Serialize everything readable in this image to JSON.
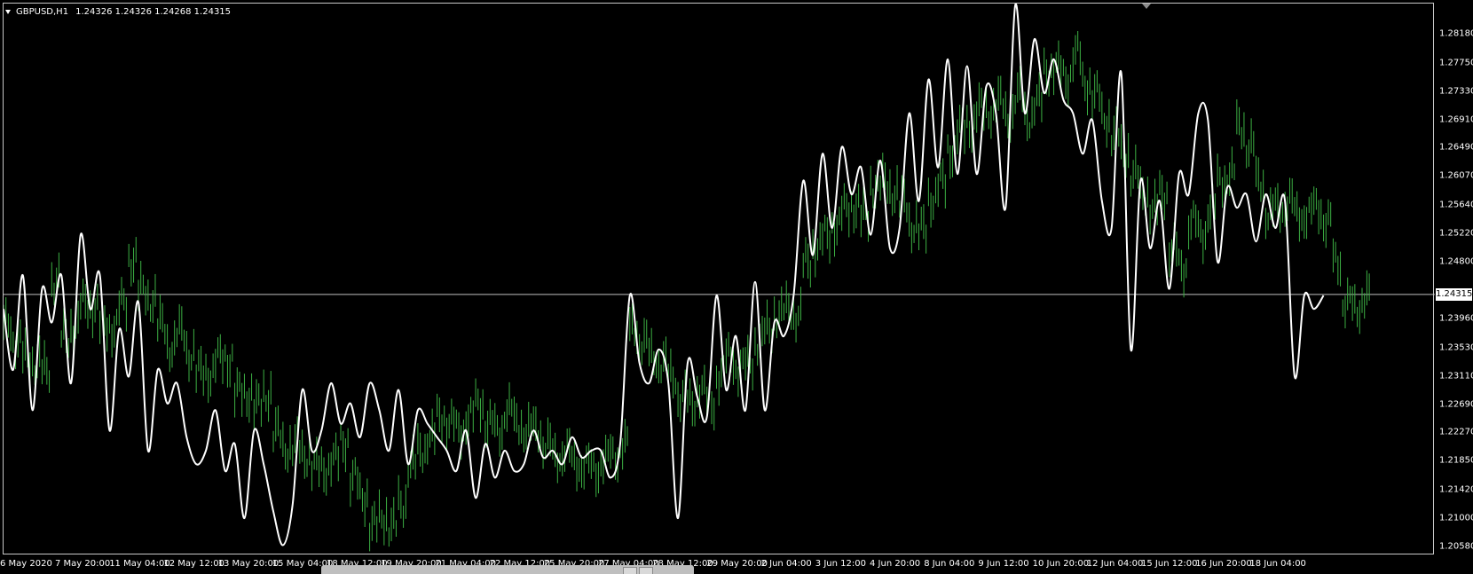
{
  "header": {
    "symbol": "GBPUSD,H1",
    "ohlc": "1.24326 1.24326 1.24268 1.24315"
  },
  "price_axis": {
    "labels": [
      "1.28180",
      "1.27750",
      "1.27330",
      "1.26910",
      "1.26490",
      "1.26070",
      "1.25640",
      "1.25220",
      "1.24800",
      "1.23960",
      "1.23530",
      "1.23110",
      "1.22690",
      "1.22270",
      "1.21850",
      "1.21420",
      "1.21000",
      "1.20580"
    ],
    "current_price": "1.24315"
  },
  "time_axis": {
    "labels": [
      "6 May 2020",
      "7 May 20:00",
      "11 May 04:00",
      "12 May 12:00",
      "13 May 20:00",
      "15 May 04:00",
      "18 May 12:00",
      "19 May 20:00",
      "21 May 04:00",
      "22 May 12:00",
      "25 May 20:00",
      "27 May 04:00",
      "28 May 12:00",
      "29 May 20:00",
      "2 Jun 04:00",
      "3 Jun 12:00",
      "4 Jun 20:00",
      "8 Jun 04:00",
      "9 Jun 12:00",
      "10 Jun 20:00",
      "12 Jun 04:00",
      "15 Jun 12:00",
      "16 Jun 20:00",
      "18 Jun 04:00"
    ]
  },
  "colors": {
    "background": "#000000",
    "bar": "#3cb043",
    "indicator": "#ffffff",
    "price_line": "#c0c0c0"
  },
  "chart_data": {
    "type": "line",
    "title": "",
    "xlabel": "",
    "ylabel": "",
    "ylim": [
      1.2058,
      1.286
    ],
    "series": [
      {
        "values": [
          1.239,
          1.236,
          1.234,
          1.233,
          1.232,
          1.245,
          1.237,
          1.238,
          1.242,
          1.241,
          1.239,
          1.238,
          1.242,
          1.248,
          1.244,
          1.242,
          1.239,
          1.235,
          1.238,
          1.234,
          1.232,
          1.231,
          1.234,
          1.233,
          1.229,
          1.228,
          1.227,
          1.228,
          1.223,
          1.22,
          1.221,
          1.219,
          1.218,
          1.217,
          1.219,
          1.221,
          1.216,
          1.213,
          1.209,
          1.21,
          1.209,
          1.212,
          1.218,
          1.22,
          1.222,
          1.225,
          1.224,
          1.223,
          1.225,
          1.227,
          1.224,
          1.223,
          1.226,
          1.224,
          1.223,
          1.223,
          1.221,
          1.219,
          1.22,
          1.218,
          1.218,
          1.217,
          1.219,
          1.219,
          1.221,
          1.238,
          1.236,
          1.234,
          1.233,
          1.231,
          1.228,
          1.227,
          1.229,
          1.227,
          1.231,
          1.234,
          1.232,
          1.233,
          1.236,
          1.238,
          1.24,
          1.241,
          1.24,
          1.248,
          1.25,
          1.252,
          1.253,
          1.256,
          1.256,
          1.255,
          1.259,
          1.26,
          1.258,
          1.257,
          1.253,
          1.253,
          1.257,
          1.26,
          1.264,
          1.268,
          1.268,
          1.271,
          1.27,
          1.272,
          1.269,
          1.273,
          1.269,
          1.272,
          1.276,
          1.277,
          1.275,
          1.279,
          1.274,
          1.273,
          1.269,
          1.267,
          1.264,
          1.261,
          1.258,
          1.256,
          1.258,
          1.25,
          1.247,
          1.254,
          1.252,
          1.256,
          1.26,
          1.261,
          1.268,
          1.265,
          1.26,
          1.255,
          1.256,
          1.257,
          1.255,
          1.255,
          1.256,
          1.254,
          1.248,
          1.242,
          1.241,
          1.243
        ],
        "indicator": [
          1.241,
          1.232,
          1.246,
          1.226,
          1.244,
          1.239,
          1.246,
          1.23,
          1.252,
          1.241,
          1.246,
          1.223,
          1.238,
          1.231,
          1.242,
          1.22,
          1.232,
          1.227,
          1.23,
          1.222,
          1.218,
          1.22,
          1.226,
          1.217,
          1.221,
          1.21,
          1.223,
          1.218,
          1.211,
          1.206,
          1.212,
          1.229,
          1.22,
          1.223,
          1.23,
          1.224,
          1.227,
          1.222,
          1.23,
          1.226,
          1.22,
          1.229,
          1.218,
          1.226,
          1.224,
          1.222,
          1.22,
          1.217,
          1.223,
          1.213,
          1.221,
          1.216,
          1.22,
          1.217,
          1.218,
          1.223,
          1.219,
          1.22,
          1.218,
          1.222,
          1.219,
          1.22,
          1.22,
          1.216,
          1.221,
          1.243,
          1.233,
          1.23,
          1.235,
          1.23,
          1.21,
          1.233,
          1.228,
          1.225,
          1.243,
          1.229,
          1.237,
          1.226,
          1.245,
          1.226,
          1.239,
          1.237,
          1.243,
          1.26,
          1.249,
          1.264,
          1.253,
          1.265,
          1.258,
          1.262,
          1.252,
          1.263,
          1.25,
          1.253,
          1.27,
          1.257,
          1.275,
          1.262,
          1.278,
          1.261,
          1.277,
          1.261,
          1.274,
          1.27,
          1.256,
          1.286,
          1.27,
          1.281,
          1.273,
          1.278,
          1.272,
          1.27,
          1.264,
          1.269,
          1.257,
          1.253,
          1.276,
          1.235,
          1.26,
          1.25,
          1.257,
          1.244,
          1.261,
          1.258,
          1.27,
          1.269,
          1.248,
          1.259,
          1.256,
          1.258,
          1.251,
          1.258,
          1.253,
          1.257,
          1.231,
          1.243,
          1.241,
          1.243
        ]
      }
    ],
    "grid": false
  }
}
